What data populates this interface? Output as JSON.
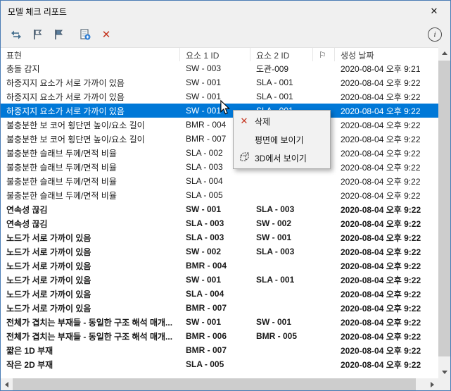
{
  "window": {
    "title": "모델 체크 리포트",
    "close_glyph": "✕"
  },
  "toolbar": {
    "icons": [
      "select-elements-icon",
      "flag-report-icon",
      "flag-icon",
      "add-report-icon",
      "delete-icon",
      "info-icon"
    ],
    "delete_glyph": "✕",
    "info_glyph": "i"
  },
  "table": {
    "columns": [
      "표현",
      "요소 1 ID",
      "요소 2 ID",
      "⚐",
      "생성 날짜"
    ],
    "rows": [
      {
        "desc": "충돌 감지",
        "id1": "SW - 003",
        "id2": "도관-009",
        "flag": "",
        "date": "2020-08-04 오후 9:21",
        "bold": false,
        "selected": false
      },
      {
        "desc": "하중지지 요소가 서로 가까이 있음",
        "id1": "SW - 001",
        "id2": "SLA - 001",
        "flag": "",
        "date": "2020-08-04 오후 9:22",
        "bold": false,
        "selected": false
      },
      {
        "desc": "하중지지 요소가 서로 가까이 있음",
        "id1": "SW - 001",
        "id2": "SLA - 001",
        "flag": "",
        "date": "2020-08-04 오후 9:22",
        "bold": false,
        "selected": false
      },
      {
        "desc": "하중지지 요소가 서로 가까이 있음",
        "id1": "SW - 001",
        "id2": "SLA - 001",
        "flag": "",
        "date": "2020-08-04 오후 9:22",
        "bold": false,
        "selected": true
      },
      {
        "desc": "불충분한 보 코어 횡단면 높이/요소 길이",
        "id1": "BMR - 004",
        "id2": "",
        "flag": "",
        "date": "2020-08-04 오후 9:22",
        "bold": false,
        "selected": false
      },
      {
        "desc": "불충분한 보 코어 횡단면 높이/요소 길이",
        "id1": "BMR - 007",
        "id2": "",
        "flag": "",
        "date": "2020-08-04 오후 9:22",
        "bold": false,
        "selected": false
      },
      {
        "desc": "불충분한 슬래브 두께/면적 비율",
        "id1": "SLA - 002",
        "id2": "",
        "flag": "",
        "date": "2020-08-04 오후 9:22",
        "bold": false,
        "selected": false
      },
      {
        "desc": "불충분한 슬래브 두께/면적 비율",
        "id1": "SLA - 003",
        "id2": "",
        "flag": "",
        "date": "2020-08-04 오후 9:22",
        "bold": false,
        "selected": false
      },
      {
        "desc": "불충분한 슬래브 두께/면적 비율",
        "id1": "SLA - 004",
        "id2": "",
        "flag": "",
        "date": "2020-08-04 오후 9:22",
        "bold": false,
        "selected": false
      },
      {
        "desc": "불충분한 슬래브 두께/면적 비율",
        "id1": "SLA - 005",
        "id2": "",
        "flag": "",
        "date": "2020-08-04 오후 9:22",
        "bold": false,
        "selected": false
      },
      {
        "desc": "연속성 끊김",
        "id1": "SW - 001",
        "id2": "SLA - 003",
        "flag": "",
        "date": "2020-08-04 오후 9:22",
        "bold": true,
        "selected": false
      },
      {
        "desc": "연속성 끊김",
        "id1": "SLA - 003",
        "id2": "SW - 002",
        "flag": "",
        "date": "2020-08-04 오후 9:22",
        "bold": true,
        "selected": false
      },
      {
        "desc": "노드가 서로 가까이 있음",
        "id1": "SLA - 003",
        "id2": "SW - 001",
        "flag": "",
        "date": "2020-08-04 오후 9:22",
        "bold": true,
        "selected": false
      },
      {
        "desc": "노드가 서로 가까이 있음",
        "id1": "SW - 002",
        "id2": "SLA - 003",
        "flag": "",
        "date": "2020-08-04 오후 9:22",
        "bold": true,
        "selected": false
      },
      {
        "desc": "노드가 서로 가까이 있음",
        "id1": "BMR - 004",
        "id2": "",
        "flag": "",
        "date": "2020-08-04 오후 9:22",
        "bold": true,
        "selected": false
      },
      {
        "desc": "노드가 서로 가까이 있음",
        "id1": "SW - 001",
        "id2": "SLA - 001",
        "flag": "",
        "date": "2020-08-04 오후 9:22",
        "bold": true,
        "selected": false
      },
      {
        "desc": "노드가 서로 가까이 있음",
        "id1": "SLA - 004",
        "id2": "",
        "flag": "",
        "date": "2020-08-04 오후 9:22",
        "bold": true,
        "selected": false
      },
      {
        "desc": "노드가 서로 가까이 있음",
        "id1": "BMR - 007",
        "id2": "",
        "flag": "",
        "date": "2020-08-04 오후 9:22",
        "bold": true,
        "selected": false
      },
      {
        "desc": "전체가 겹치는 부재들 - 동일한 구조 해석 매개...",
        "id1": "SW - 001",
        "id2": "SW - 001",
        "flag": "",
        "date": "2020-08-04 오후 9:22",
        "bold": true,
        "selected": false
      },
      {
        "desc": "전체가 겹치는 부재들 - 동일한 구조 해석 매개...",
        "id1": "BMR - 006",
        "id2": "BMR - 005",
        "flag": "",
        "date": "2020-08-04 오후 9:22",
        "bold": true,
        "selected": false
      },
      {
        "desc": "짧은 1D 부재",
        "id1": "BMR - 007",
        "id2": "",
        "flag": "",
        "date": "2020-08-04 오후 9:22",
        "bold": true,
        "selected": false
      },
      {
        "desc": "작은 2D 부재",
        "id1": "SLA - 005",
        "id2": "",
        "flag": "",
        "date": "2020-08-04 오후 9:22",
        "bold": true,
        "selected": false
      }
    ]
  },
  "context_menu": {
    "items": [
      {
        "label": "삭제",
        "icon": "delete-icon",
        "glyph": "✕"
      },
      {
        "label": "평면에 보이기",
        "icon": ""
      },
      {
        "label": "3D에서 보이기",
        "icon": "show-in-3d-icon"
      }
    ]
  }
}
